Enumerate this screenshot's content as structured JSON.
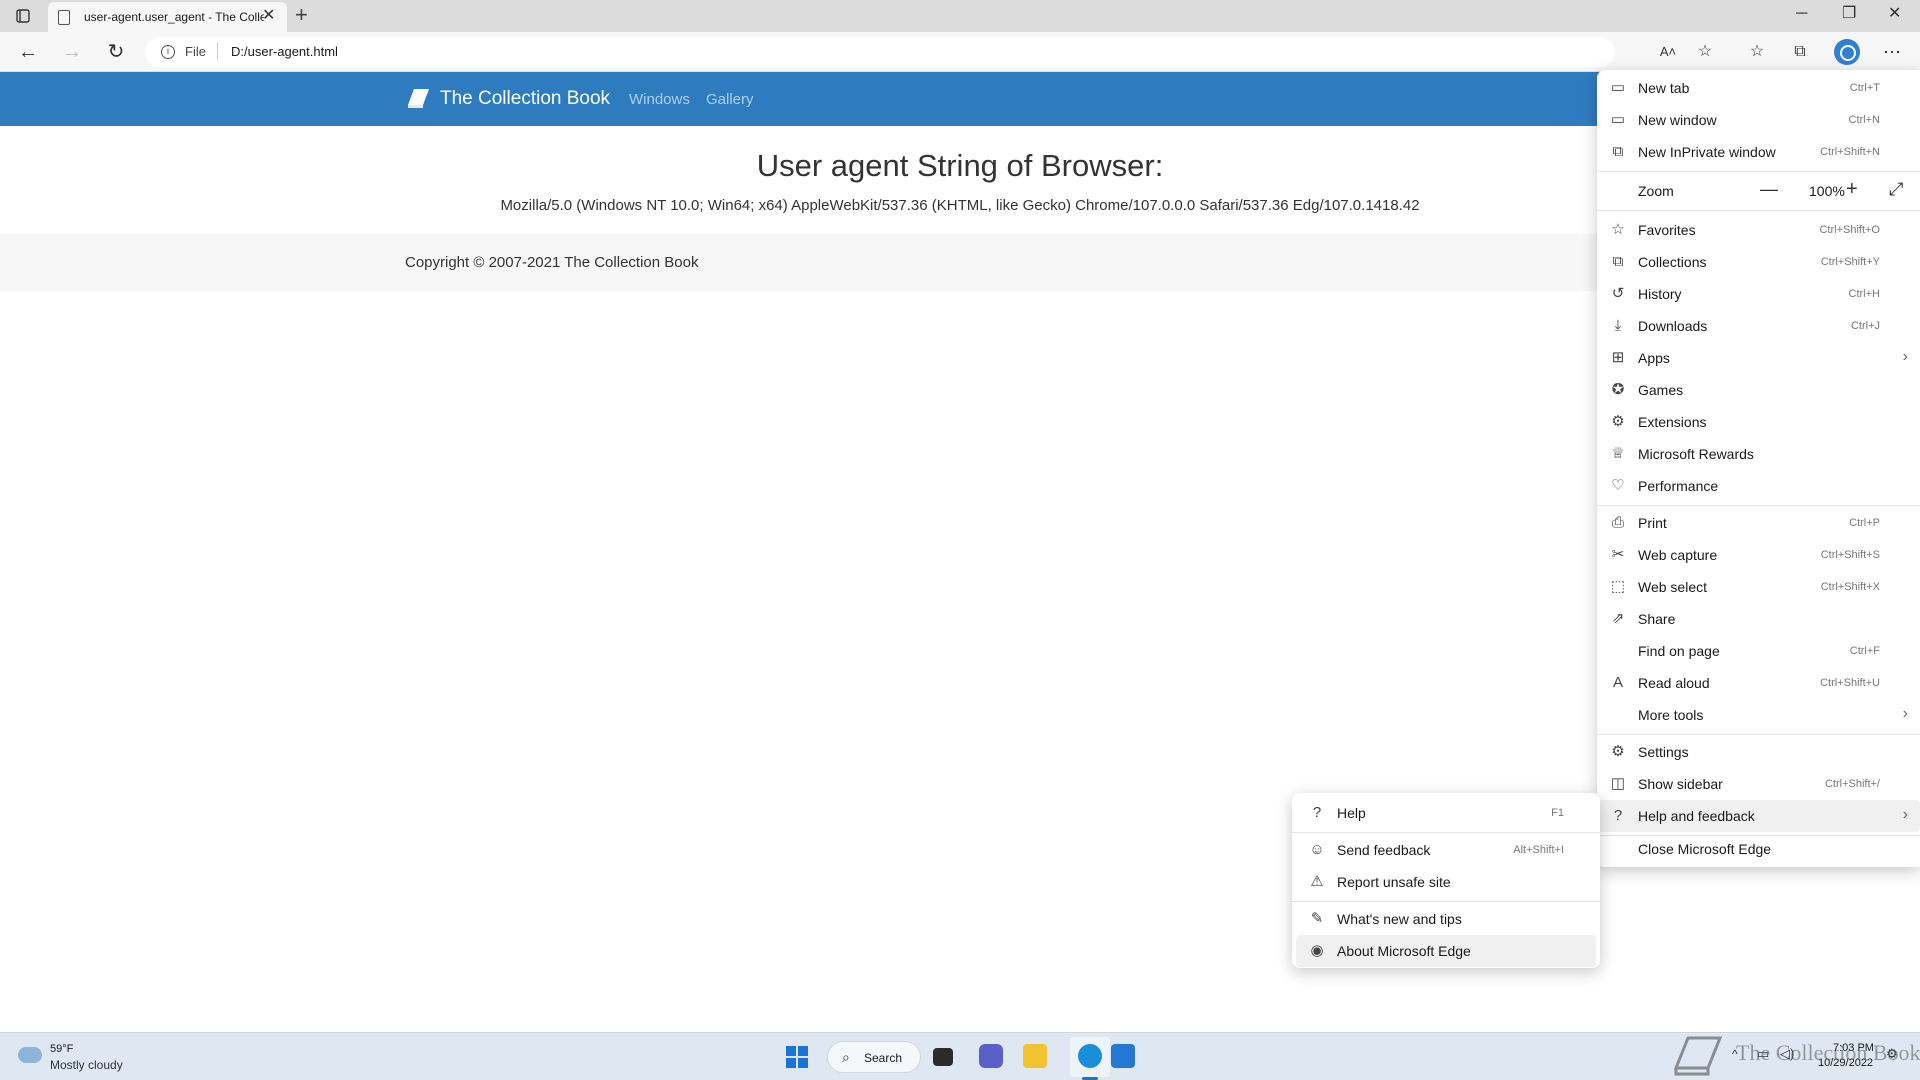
{
  "browser": {
    "tab_title": "user-agent.user_agent - The Collection Book",
    "new_tab_symbol": "+",
    "close_symbol": "✕",
    "address_scheme": "File",
    "address_url": "D:/user-agent.html"
  },
  "site": {
    "brand": "The Collection Book",
    "nav": [
      "Windows",
      "Gallery"
    ],
    "heading": "User agent String of Browser:",
    "user_agent": "Mozilla/5.0 (Windows NT 10.0; Win64; x64) AppleWebKit/537.36 (KHTML, like Gecko) Chrome/107.0.0.0 Safari/537.36 Edg/107.0.1418.42",
    "copyright": "Copyright © 2007-2021 The Collection Book",
    "brand_color": "#2f7bbf"
  },
  "menu": {
    "new_tab": {
      "label": "New tab",
      "shortcut": "Ctrl+T",
      "icon": "new-tab-icon"
    },
    "new_window": {
      "label": "New window",
      "shortcut": "Ctrl+N",
      "icon": "new-window-icon"
    },
    "new_inprivate": {
      "label": "New InPrivate window",
      "shortcut": "Ctrl+Shift+N",
      "icon": "inprivate-icon"
    },
    "zoom": {
      "label": "Zoom",
      "value": "100%",
      "minus": "—",
      "plus": "+",
      "fullscreen": "⤢"
    },
    "favorites": {
      "label": "Favorites",
      "shortcut": "Ctrl+Shift+O",
      "icon": "star-icon"
    },
    "collections": {
      "label": "Collections",
      "shortcut": "Ctrl+Shift+Y",
      "icon": "collections-icon"
    },
    "history": {
      "label": "History",
      "shortcut": "Ctrl+H",
      "icon": "history-icon"
    },
    "downloads": {
      "label": "Downloads",
      "shortcut": "Ctrl+J",
      "icon": "download-icon"
    },
    "apps": {
      "label": "Apps",
      "icon": "apps-icon"
    },
    "games": {
      "label": "Games",
      "icon": "games-icon"
    },
    "extensions": {
      "label": "Extensions",
      "icon": "extensions-icon"
    },
    "rewards": {
      "label": "Microsoft Rewards",
      "icon": "rewards-icon"
    },
    "performance": {
      "label": "Performance",
      "icon": "performance-icon"
    },
    "print": {
      "label": "Print",
      "shortcut": "Ctrl+P",
      "icon": "print-icon"
    },
    "web_capture": {
      "label": "Web capture",
      "shortcut": "Ctrl+Shift+S",
      "icon": "web-capture-icon"
    },
    "web_select": {
      "label": "Web select",
      "shortcut": "Ctrl+Shift+X",
      "icon": "web-select-icon"
    },
    "share": {
      "label": "Share",
      "icon": "share-icon"
    },
    "find": {
      "label": "Find on page",
      "shortcut": "Ctrl+F"
    },
    "read_aloud": {
      "label": "Read aloud",
      "shortcut": "Ctrl+Shift+U",
      "icon": "read-aloud-icon"
    },
    "more_tools": {
      "label": "More tools"
    },
    "settings": {
      "label": "Settings",
      "icon": "gear-icon"
    },
    "show_sidebar": {
      "label": "Show sidebar",
      "shortcut": "Ctrl+Shift+/",
      "icon": "sidebar-icon"
    },
    "help_feedback": {
      "label": "Help and feedback",
      "icon": "help-icon"
    },
    "close_edge": {
      "label": "Close Microsoft Edge"
    },
    "arrow": "›"
  },
  "submenu": {
    "help": {
      "label": "Help",
      "shortcut": "F1"
    },
    "send_feedback": {
      "label": "Send feedback",
      "shortcut": "Alt+Shift+I"
    },
    "report_unsafe": {
      "label": "Report unsafe site"
    },
    "whats_new": {
      "label": "What's new and tips"
    },
    "about": {
      "label": "About Microsoft Edge"
    }
  },
  "taskbar": {
    "temperature": "59°F",
    "condition": "Mostly cloudy",
    "search_label": "Search",
    "time": "7:03 PM",
    "date": "10/29/2022",
    "watermark": "The Collection Book"
  }
}
